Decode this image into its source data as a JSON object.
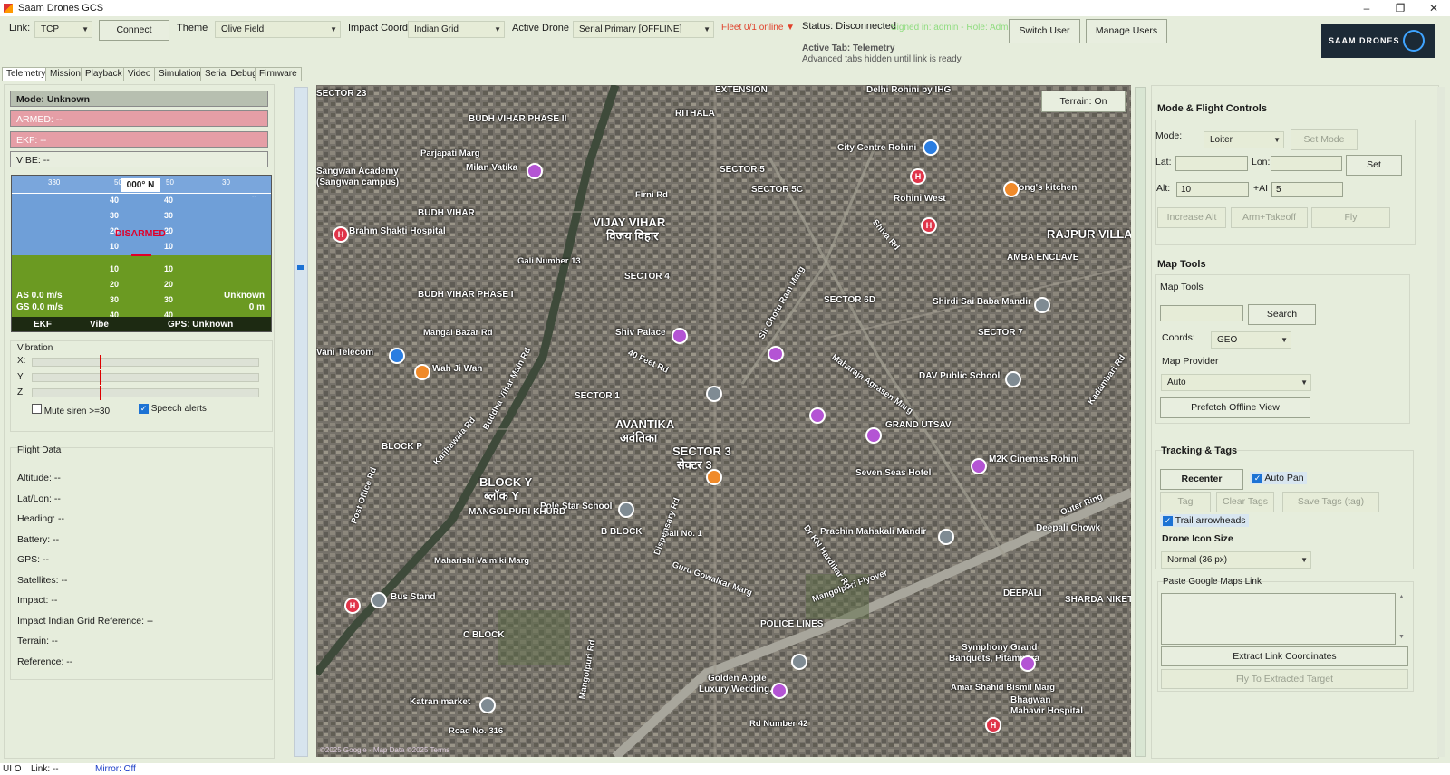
{
  "window": {
    "title": "Saam Drones GCS"
  },
  "toolbar": {
    "link_label": "Link:",
    "link_value": "TCP",
    "connect_label": "Connect",
    "theme_label": "Theme",
    "theme_value": "Olive Field",
    "impact_label": "Impact Coord",
    "impact_value": "Indian Grid",
    "drone_label": "Active Drone",
    "drone_value": "Serial Primary [OFFLINE]",
    "fleet_text": "Fleet 0/1 online ▼",
    "status_text": "Status: Disconnected",
    "signed_in": "Signed in: admin - Role: Admin",
    "active_tab": "Active Tab: Telemetry",
    "tabs_hint": "Advanced tabs hidden until link is ready",
    "switch_user": "Switch User",
    "manage_users": "Manage Users",
    "logo_text": "SAAM DRONES"
  },
  "tabs": [
    "Telemetry",
    "Mission",
    "Playback",
    "Video",
    "Simulation",
    "Serial Debug",
    "Firmware"
  ],
  "left": {
    "mode": "Mode: Unknown",
    "armed": "ARMED: --",
    "ekf": "EKF: --",
    "vibe": "VIBE: --",
    "hud": {
      "heading": "000° N",
      "h_ticks": [
        "330",
        "50",
        "50",
        "30"
      ],
      "pitch_up": [
        "40",
        "30",
        "20",
        "10"
      ],
      "pitch_down": [
        "10",
        "20",
        "30",
        "40"
      ],
      "disarmed": "DISARMED",
      "as": "AS 0.0 m/s",
      "gs": "GS 0.0 m/s",
      "mode_right": "Unknown",
      "alt_right": "0 m",
      "ekf": "EKF",
      "vibe": "Vibe",
      "gps": "GPS: Unknown",
      "dash": "--"
    },
    "vibration": {
      "title": "Vibration",
      "x": "X:",
      "y": "Y:",
      "z": "Z:"
    },
    "mute_siren": "Mute siren >=30",
    "speech_alerts": "Speech alerts",
    "flight_data": {
      "title": "Flight Data",
      "lines": [
        "Altitude: --",
        "Lat/Lon: --",
        "Heading: --",
        "Battery: --",
        "GPS: --",
        "Satellites: --",
        "Impact: --",
        "Impact Indian Grid Reference: --",
        "Terrain: --",
        "Reference: --"
      ]
    }
  },
  "map": {
    "terrain_btn": "Terrain: On",
    "attribution": "©2025 Google · Map Data ©2025 Terms",
    "labels": [
      {
        "t": "VIJAY VIHAR",
        "c": "big"
      },
      {
        "t": "विजय विहार",
        "c": "big"
      },
      {
        "t": "AVANTIKA",
        "c": "big"
      },
      {
        "t": "अवंतिका",
        "c": "big"
      },
      {
        "t": "SECTOR 3",
        "c": "big"
      },
      {
        "t": "सेक्टर 3",
        "c": "big"
      },
      {
        "t": "BLOCK Y",
        "c": "big"
      },
      {
        "t": "ब्लॉक Y",
        "c": "big"
      },
      {
        "t": "RAJPUR VILLA",
        "c": "big"
      },
      {
        "t": "AMBA ENCLAVE",
        "c": ""
      },
      {
        "t": "City Centre Rohini",
        "c": ""
      },
      {
        "t": "Rohini West",
        "c": ""
      },
      {
        "t": "Wong's kitchen",
        "c": ""
      },
      {
        "t": "Delhi Rohini by IHG",
        "c": ""
      },
      {
        "t": "Milan Vatika",
        "c": ""
      },
      {
        "t": "Sangwan Academy",
        "c": ""
      },
      {
        "t": "(Sangwan campus)",
        "c": ""
      },
      {
        "t": "Brahm Shakti Hospital",
        "c": ""
      },
      {
        "t": "Parjapati Marg",
        "c": "road"
      },
      {
        "t": "BUDH VIHAR PHASE II",
        "c": ""
      },
      {
        "t": "BUDH VIHAR",
        "c": ""
      },
      {
        "t": "BUDH VIHAR PHASE I",
        "c": ""
      },
      {
        "t": "Gali Number 13",
        "c": "road"
      },
      {
        "t": "Mangal Bazar Rd",
        "c": "road"
      },
      {
        "t": "Vani Telecom",
        "c": ""
      },
      {
        "t": "Wah Ji Wah",
        "c": ""
      },
      {
        "t": "Shiv Palace",
        "c": ""
      },
      {
        "t": "SECTOR 4",
        "c": ""
      },
      {
        "t": "SECTOR 5",
        "c": ""
      },
      {
        "t": "SECTOR 5C",
        "c": ""
      },
      {
        "t": "SECTOR 6D",
        "c": ""
      },
      {
        "t": "SECTOR 7",
        "c": ""
      },
      {
        "t": "SECTOR 1",
        "c": ""
      },
      {
        "t": "Shirdi Sai Baba Mandir",
        "c": ""
      },
      {
        "t": "DAV Public School",
        "c": ""
      },
      {
        "t": "GRAND UTSAV",
        "c": ""
      },
      {
        "t": "Seven Seas Hotel",
        "c": ""
      },
      {
        "t": "M2K Cinemas Rohini",
        "c": ""
      },
      {
        "t": "Pole Star School",
        "c": ""
      },
      {
        "t": "B BLOCK",
        "c": ""
      },
      {
        "t": "MANGOLPURI KHURD",
        "c": ""
      },
      {
        "t": "Maharishi Valmiki Marg",
        "c": "road"
      },
      {
        "t": "Bus Stand",
        "c": ""
      },
      {
        "t": "Prachin Mahakali Mandir",
        "c": ""
      },
      {
        "t": "Deepali Chowk",
        "c": ""
      },
      {
        "t": "Mangolpuri Flyover",
        "c": "road"
      },
      {
        "t": "Guru Gowalkar Marg",
        "c": "road"
      },
      {
        "t": "POLICE LINES",
        "c": ""
      },
      {
        "t": "Golden Apple",
        "c": ""
      },
      {
        "t": "Luxury Wedding...",
        "c": ""
      },
      {
        "t": "Symphony Grand",
        "c": ""
      },
      {
        "t": "Banquets, Pitampura",
        "c": ""
      },
      {
        "t": "Amar Shahid Bismil Marg",
        "c": "road"
      },
      {
        "t": "Bhagwan",
        "c": ""
      },
      {
        "t": "Mahavir Hospital",
        "c": ""
      },
      {
        "t": "Katran market",
        "c": ""
      },
      {
        "t": "Road No. 316",
        "c": "road"
      },
      {
        "t": "Rd Number 42",
        "c": "road"
      },
      {
        "t": "DEEPALI",
        "c": ""
      },
      {
        "t": "SHARDA NIKETAN",
        "c": ""
      },
      {
        "t": "Outer Ring",
        "c": "road"
      },
      {
        "t": "40 Feet Rd",
        "c": "road"
      },
      {
        "t": "Karjhawala Rd",
        "c": "road"
      },
      {
        "t": "Buddha Vihar Main Rd",
        "c": "road"
      },
      {
        "t": "Maharaja Agrasen Marg",
        "c": "road"
      },
      {
        "t": "Sir Chotu Ram Marg",
        "c": "road"
      },
      {
        "t": "Shiva Rd",
        "c": "road"
      },
      {
        "t": "Kadambari Rd",
        "c": "road"
      },
      {
        "t": "Post Office Rd",
        "c": "road"
      },
      {
        "t": "C BLOCK",
        "c": ""
      },
      {
        "t": "BLOCK P",
        "c": ""
      },
      {
        "t": "Dr KN Hardikar Rd",
        "c": "road"
      },
      {
        "t": "Gali No. 1",
        "c": "road"
      },
      {
        "t": "Mangolpuri Rd",
        "c": "road"
      },
      {
        "t": "Dispensary Rd",
        "c": "road"
      },
      {
        "t": "Firni Rd",
        "c": "road"
      },
      {
        "t": "RITHALA",
        "c": ""
      },
      {
        "t": "EXTENSION",
        "c": ""
      },
      {
        "t": "SECTOR 23",
        "c": ""
      }
    ]
  },
  "right": {
    "mode_title": "Mode & Flight Controls",
    "mode_label": "Mode:",
    "mode_value": "Loiter",
    "set_mode": "Set Mode",
    "lat_label": "Lat:",
    "lon_label": "Lon:",
    "set": "Set",
    "alt_label": "Alt:",
    "alt_value": "10",
    "ai_label": "+AI",
    "ai_value": "5",
    "increase_alt": "Increase Alt",
    "arm_takeoff": "Arm+Takeoff",
    "fly": "Fly",
    "map_tools_title": "Map Tools",
    "map_tools_sub": "Map Tools",
    "search": "Search",
    "coords_label": "Coords:",
    "coords_value": "GEO",
    "provider_label": "Map Provider",
    "provider_value": "Auto",
    "prefetch": "Prefetch Offline View",
    "tracking_title": "Tracking & Tags",
    "recenter": "Recenter",
    "auto_pan": "Auto Pan",
    "tag": "Tag",
    "clear_tags": "Clear Tags",
    "save_tags": "Save Tags (tag)",
    "trail": "Trail arrowheads",
    "icon_size_title": "Drone Icon Size",
    "icon_size_value": "Normal (36 px)",
    "paste_label": "Paste Google Maps Link",
    "extract": "Extract Link Coordinates",
    "fly_to": "Fly To Extracted Target"
  },
  "statusline": {
    "ui": "UI O",
    "link": "Link: --",
    "mirror": "Mirror: Off"
  },
  "colors": {
    "accent": "#1c72d4",
    "armed": "#e59ea6",
    "sky": "#6f9fd8",
    "ground": "#6b9a22",
    "bg": "#e6eddc"
  }
}
